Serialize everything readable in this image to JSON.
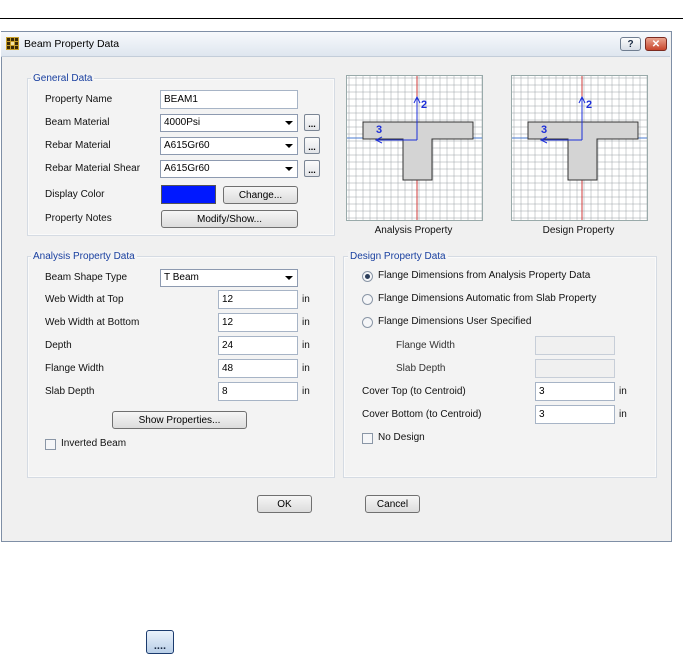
{
  "window": {
    "title": "Beam Property Data",
    "help_glyph": "?",
    "close_glyph": "✕"
  },
  "general": {
    "title": "General Data",
    "property_name_label": "Property Name",
    "property_name_value": "BEAM1",
    "beam_material_label": "Beam Material",
    "beam_material_value": "4000Psi",
    "rebar_material_label": "Rebar Material",
    "rebar_material_value": "A615Gr60",
    "rebar_shear_label": "Rebar Material Shear",
    "rebar_shear_value": "A615Gr60",
    "ellipsis": "...",
    "display_color_label": "Display Color",
    "display_color": "#0018ff",
    "change_button": "Change...",
    "property_notes_label": "Property Notes",
    "modify_button": "Modify/Show..."
  },
  "previews": {
    "analysis_caption": "Analysis Property",
    "design_caption": "Design Property",
    "axis_2": "2",
    "axis_3": "3"
  },
  "analysis": {
    "title": "Analysis Property Data",
    "shape_type_label": "Beam Shape Type",
    "shape_type_value": "T Beam",
    "web_top_label": "Web Width at Top",
    "web_top_value": "12",
    "web_bottom_label": "Web Width at Bottom",
    "web_bottom_value": "12",
    "depth_label": "Depth",
    "depth_value": "24",
    "flange_width_label": "Flange Width",
    "flange_width_value": "48",
    "slab_depth_label": "Slab Depth",
    "slab_depth_value": "8",
    "unit": "in",
    "show_properties_button": "Show Properties...",
    "inverted_beam_label": "Inverted Beam"
  },
  "design": {
    "title": "Design Property  Data",
    "radio_1": "Flange Dimensions from Analysis Property Data",
    "radio_2": "Flange Dimensions Automatic from Slab Property",
    "radio_3": "Flange Dimensions User Specified",
    "flange_width_label": "Flange Width",
    "slab_depth_label": "Slab Depth",
    "cover_top_label": "Cover Top (to Centroid)",
    "cover_top_value": "3",
    "cover_bottom_label": "Cover Bottom (to Centroid)",
    "cover_bottom_value": "3",
    "unit": "in",
    "no_design_label": "No Design"
  },
  "footer": {
    "ok_button": "OK",
    "cancel_button": "Cancel"
  },
  "extra": {
    "dots_icon_text": "...."
  }
}
